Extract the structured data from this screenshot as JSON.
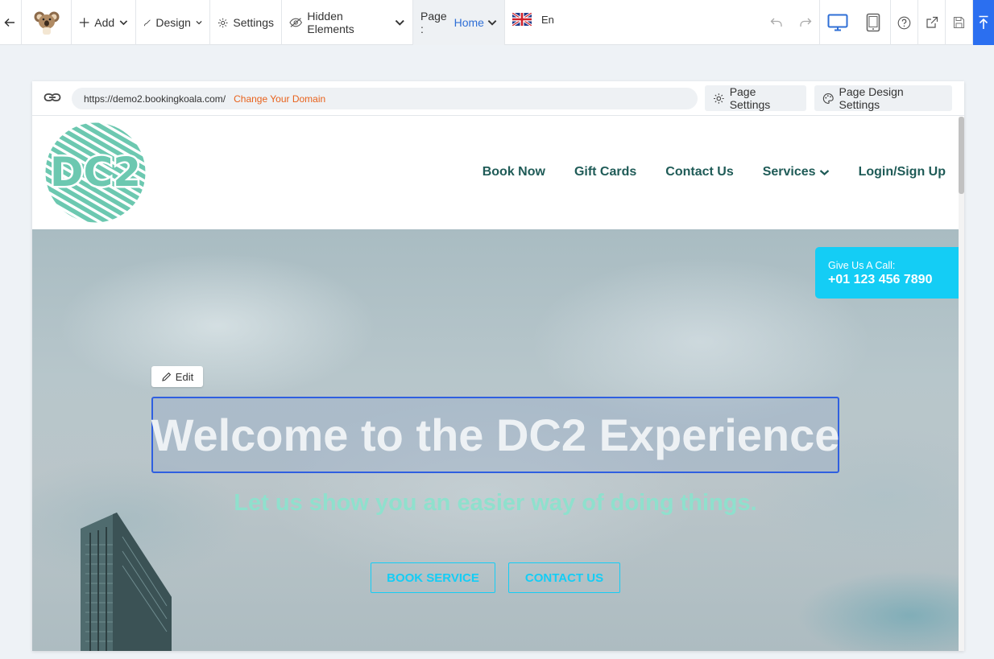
{
  "toolbar": {
    "add_label": "Add",
    "design_label": "Design",
    "settings_label": "Settings",
    "hidden_elements_label": "Hidden Elements",
    "page_label": "Page :",
    "page_value": "Home",
    "language": "En",
    "accent_color": "#2b6ff0"
  },
  "frame": {
    "url": "https://demo2.bookingkoala.com/",
    "change_domain": "Change Your Domain",
    "page_settings": "Page Settings",
    "page_design_settings": "Page Design Settings"
  },
  "site": {
    "logo_text": "DC2",
    "nav": [
      "Book Now",
      "Gift Cards",
      "Contact Us",
      "Services",
      "Login/Sign Up"
    ],
    "call_label": "Give Us A Call:",
    "call_number": "+01 123 456 7890",
    "edit_label": "Edit",
    "headline": "Welcome to the DC2 Experience",
    "subheadline": "Let us show you an easier way of doing things.",
    "book_service": "BOOK SERVICE",
    "contact_us": "CONTACT US",
    "brand_teal": "#6cc8b0",
    "nav_color": "#1f5b57",
    "cta_color": "#14cdf5"
  }
}
